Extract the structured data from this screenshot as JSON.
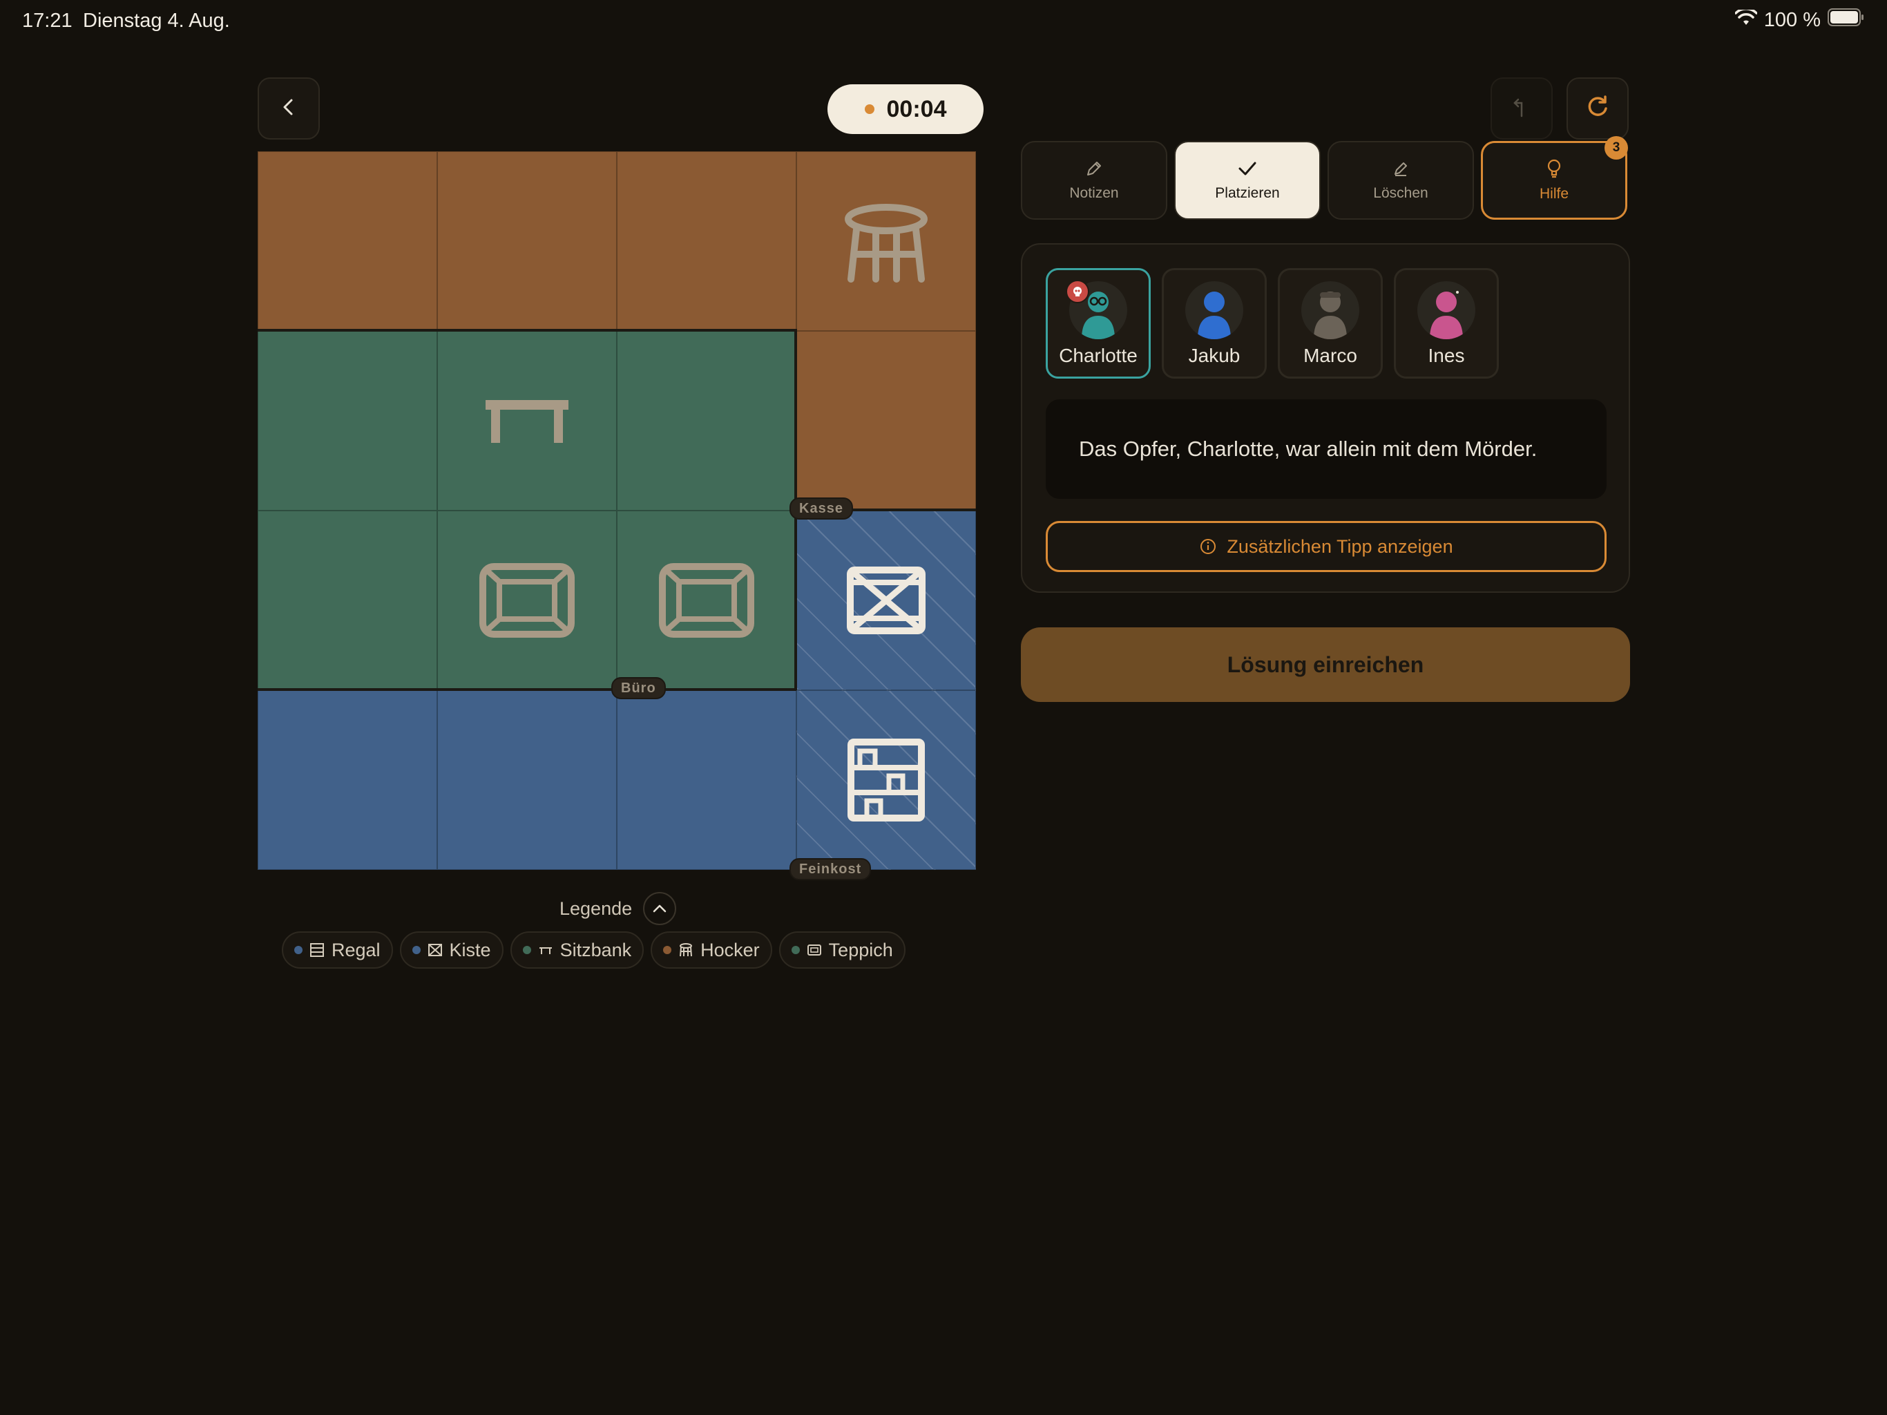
{
  "status_bar": {
    "time": "17:21",
    "date": "Dienstag 4. Aug.",
    "battery": "100 %",
    "wifi_icon": "wifi-icon",
    "battery_icon": "battery-icon"
  },
  "timer": "00:04",
  "rooms": [
    "Kasse",
    "Büro",
    "Feinkost"
  ],
  "legend": {
    "title": "Legende",
    "items": [
      {
        "label": "Regal",
        "icon": "shelf-icon",
        "color": "#41618a"
      },
      {
        "label": "Kiste",
        "icon": "crate-icon",
        "color": "#41618a"
      },
      {
        "label": "Sitzbank",
        "icon": "bench-icon",
        "color": "#416b58"
      },
      {
        "label": "Hocker",
        "icon": "stool-icon",
        "color": "#8b5a33"
      },
      {
        "label": "Teppich",
        "icon": "rug-icon",
        "color": "#416b58"
      }
    ]
  },
  "tools": [
    {
      "label": "Notizen",
      "icon": "pencil-icon"
    },
    {
      "label": "Platzieren",
      "icon": "check-icon"
    },
    {
      "label": "Löschen",
      "icon": "eraser-icon"
    },
    {
      "label": "Hilfe",
      "icon": "lightbulb-icon",
      "badge": "3"
    }
  ],
  "people": [
    {
      "name": "Charlotte",
      "color": "#2f9a96",
      "selected": true,
      "victim": true
    },
    {
      "name": "Jakub",
      "color": "#2f6ed0"
    },
    {
      "name": "Marco",
      "color": "#6b6358"
    },
    {
      "name": "Ines",
      "color": "#c9558e"
    }
  ],
  "clue_text": "Das Opfer, Charlotte, war allein mit dem Mörder.",
  "tip_button": "Zusätzlichen Tipp anzeigen",
  "submit_button": "Lösung einreichen",
  "colors": {
    "accent": "#d98a35",
    "brown_room": "#8b5a33",
    "green_room": "#416b58",
    "blue_room": "#41618a"
  }
}
